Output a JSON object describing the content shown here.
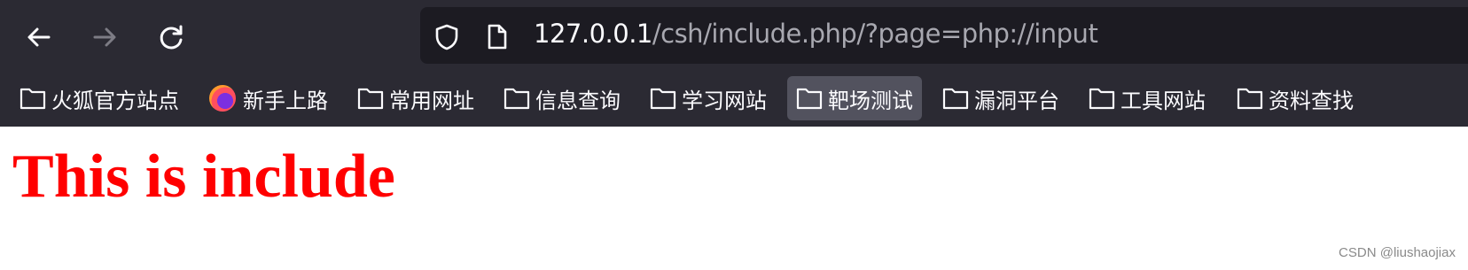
{
  "browser": {
    "nav": {
      "back_icon": "arrow-left-icon",
      "forward_icon": "arrow-right-icon",
      "reload_icon": "reload-icon",
      "forward_enabled": false
    },
    "urlbar": {
      "host": "127.0.0.1",
      "path": "/csh/include.php/?page=php://input",
      "icons": [
        "shield-icon",
        "page-icon"
      ]
    },
    "bookmarks": [
      {
        "label": "火狐官方站点",
        "icon": "folder-icon"
      },
      {
        "label": "新手上路",
        "icon": "firefox-icon"
      },
      {
        "label": "常用网址",
        "icon": "folder-icon"
      },
      {
        "label": "信息查询",
        "icon": "folder-icon"
      },
      {
        "label": "学习网站",
        "icon": "folder-icon"
      },
      {
        "label": "靶场测试",
        "icon": "folder-icon",
        "active": true
      },
      {
        "label": "漏洞平台",
        "icon": "folder-icon"
      },
      {
        "label": "工具网站",
        "icon": "folder-icon"
      },
      {
        "label": "资料查找",
        "icon": "folder-icon"
      }
    ]
  },
  "page": {
    "heading": "This is include",
    "watermark": "CSDN @liushaojiax"
  },
  "colors": {
    "chrome_bg": "#2b2a33",
    "urlbar_bg": "#1c1b22",
    "heading": "#ff0000"
  }
}
